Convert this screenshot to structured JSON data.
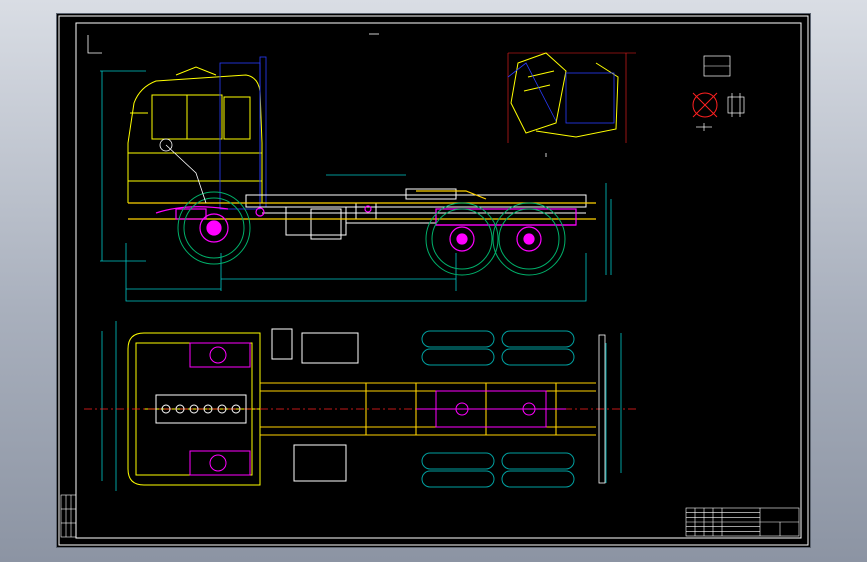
{
  "window": {
    "background_top": "#d9dde4",
    "background_bottom": "#8c94a3"
  },
  "drawing": {
    "sheet_background": "#000000",
    "frame_color": "#ffffff",
    "layer_colors": {
      "cab_outline": "#ffff00",
      "suspension": "#ff00ff",
      "dimensions": "#00c8c8",
      "wheels": "#00b06a",
      "chassis": "#ffffff",
      "frame_rails": "#ffd200",
      "tires_plan": "#00a0a0",
      "center_line": "#ff2020",
      "hidden": "#2a3cff"
    },
    "views": [
      "side-elevation",
      "plan-view",
      "cab-tilt-detail",
      "wheel-detail"
    ]
  },
  "title_block": {
    "rows": 6,
    "cols": 5,
    "mark_a": "",
    "mark_b": "",
    "mark_c": "",
    "mark_d": ""
  }
}
